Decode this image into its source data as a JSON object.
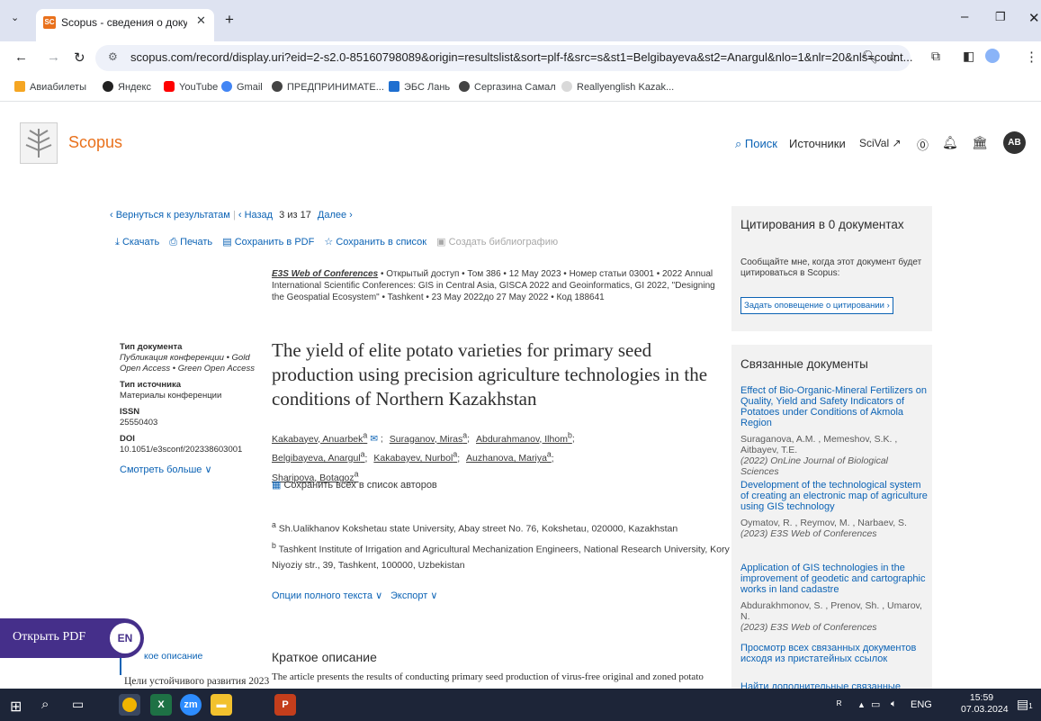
{
  "browser": {
    "tab_title": "Scopus - сведения о документ",
    "tab_favicon": "SC",
    "url": "scopus.com/record/display.uri?eid=2-s2.0-85160798089&origin=resultslist&sort=plf-f&src=s&st1=Belgibayeva&st2=Anargul&nlo=1&nlr=20&nls=count...",
    "bookmarks": [
      "Авиабилеты",
      "Яндекс",
      "YouTube",
      "Gmail",
      "ПРЕДПРИНИМАТЕ...",
      "ЭБС Лань",
      "Сергазина Самал",
      "Reallyenglish Kazak..."
    ]
  },
  "header": {
    "brand": "Scopus",
    "nav": {
      "search": "Поиск",
      "sources": "Источники",
      "scival": "SciVal ↗"
    },
    "avatar": "AB"
  },
  "nav_row": {
    "back": "‹ Вернуться к результатам",
    "prev": "‹ Назад",
    "position": "3 из 17",
    "next": "Далее ›"
  },
  "actions": {
    "download": "Скачать",
    "print": "Печать",
    "save_pdf": "Сохранить в PDF",
    "save_list": "Сохранить в список",
    "bibliography": "Создать библиографию"
  },
  "source": {
    "journal": "E3S Web of Conferences",
    "details": "• Открытый доступ • Том 386 • 12 May 2023 • Номер статьи 03001 • 2022 Annual International Scientific Conferences: GIS in Central Asia, GISCA 2022 and Geoinformatics, GI 2022, \"Designing the Geospatial Ecosystem\" • Tashkent • 23 May 2022до 27 May 2022 • Код 188641"
  },
  "meta": {
    "doc_type_label": "Тип документа",
    "doc_type_value": "Публикация конференции • Gold Open Access • Green Open Access",
    "source_type_label": "Тип источника",
    "source_type_value": "Материалы конференции",
    "issn_label": "ISSN",
    "issn_value": "25550403",
    "doi_label": "DOI",
    "doi_value": "10.1051/e3sconf/202338603001",
    "more": "Смотреть больше ∨"
  },
  "title": "The yield of elite potato varieties for primary seed production using precision agriculture technologies in the conditions of Northern Kazakhstan",
  "authors": [
    {
      "name": "Kakabayev, Anuarbek",
      "sup": "a"
    },
    {
      "name": "Suraganov, Miras",
      "sup": "a"
    },
    {
      "name": "Abdurahmanov, Ilhom",
      "sup": "b"
    },
    {
      "name": "Belgibayeva, Anargul",
      "sup": "a"
    },
    {
      "name": "Kakabayev, Nurbol",
      "sup": "a"
    },
    {
      "name": "Auzhanova, Mariya",
      "sup": "a"
    },
    {
      "name": "Sharipova, Botagoz",
      "sup": "a"
    }
  ],
  "save_authors": "Сохранить всех в список авторов",
  "affiliations": [
    {
      "sup": "a",
      "text": "Sh.Ualikhanov Kokshetau state University, Abay street No. 76, Kokshetau, 020000, Kazakhstan"
    },
    {
      "sup": "b",
      "text": "Tashkent Institute of Irrigation and Agricultural Mechanization Engineers, National Research University, Kory Niyoziy str., 39, Tashkent, 100000, Uzbekistan"
    }
  ],
  "fulltext_options": "Опции полного текста ∨",
  "export": "Экспорт ∨",
  "abstract": {
    "heading": "Краткое описание",
    "text": "The article presents the results of conducting primary seed production of virus-free original and zoned potato"
  },
  "left_nav": {
    "abstract": "кое описание",
    "sdg": "Цели устойчивого развития 2023"
  },
  "pdf_widget": {
    "label": "Открыть PDF",
    "badge": "EN"
  },
  "citations": {
    "heading": "Цитирования в 0 документах",
    "notice": "Сообщайте мне, когда этот документ будет цитироваться в Scopus:",
    "button": "Задать оповещение о цитировании ›"
  },
  "related": {
    "heading": "Связанные документы",
    "items": [
      {
        "title": "Effect of Bio-Organic-Mineral Fertilizers on Quality, Yield and Safety Indicators of Potatoes under Conditions of Akmola Region",
        "authors": "Suraganova, A.M. , Memeshov, S.K. , Aitbayev, T.E.",
        "source": "(2022) OnLine Journal of Biological Sciences"
      },
      {
        "title": "Development of the technological system of creating an electronic map of agriculture using GIS technology",
        "authors": "Oymatov, R. , Reymov, M. , Narbaev, S.",
        "source": "(2023) E3S Web of Conferences"
      },
      {
        "title": "Application of GIS technologies in the improvement of geodetic and cartographic works in land cadastre",
        "authors": "Abdurakhmonov, S. , Prenov, Sh. , Umarov, N.",
        "source": "(2023) E3S Web of Conferences"
      }
    ],
    "view_all": "Просмотр всех связанных документов исходя из пристатейных ссылок",
    "find_more": "Найти дополнительные связанные"
  },
  "taskbar": {
    "lang": "ENG",
    "time": "15:59",
    "date": "07.03.2024",
    "notif_count": "1"
  }
}
